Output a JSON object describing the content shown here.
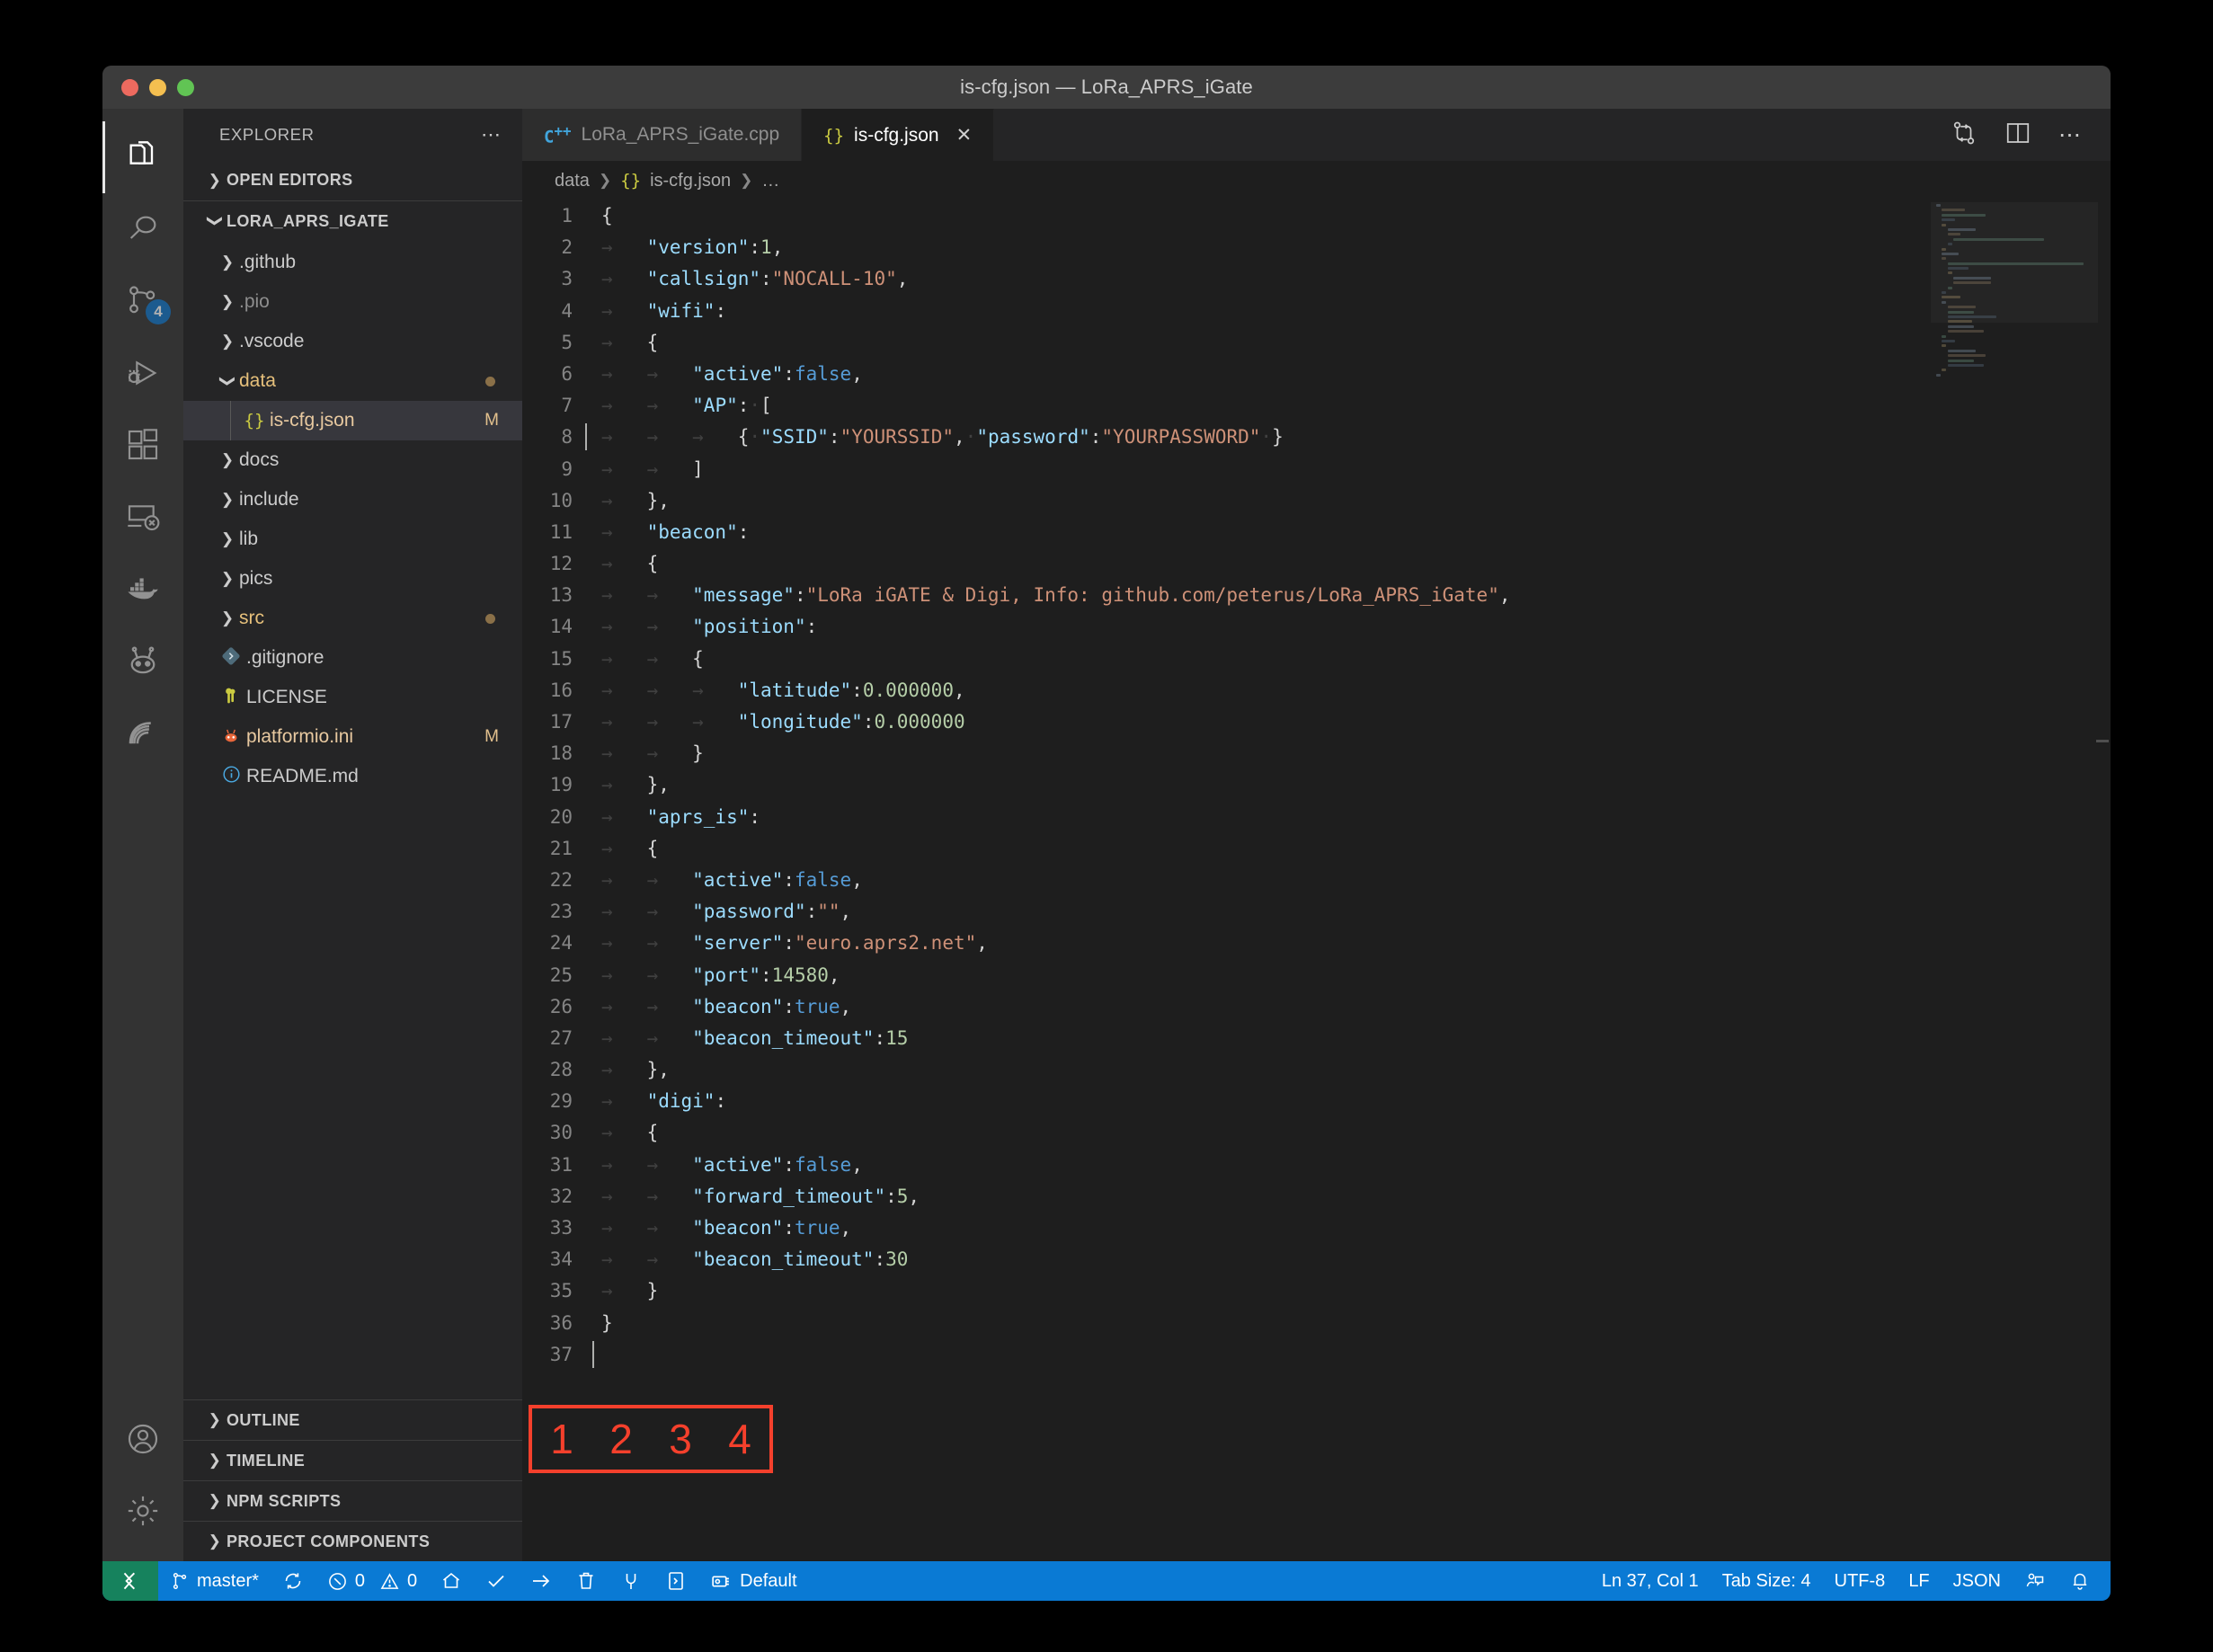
{
  "window": {
    "title": "is-cfg.json — LoRa_APRS_iGate"
  },
  "activitybar": {
    "items": [
      {
        "name": "explorer-icon",
        "badge": null
      },
      {
        "name": "search-icon",
        "badge": null
      },
      {
        "name": "source-control-icon",
        "badge": "4"
      },
      {
        "name": "run-and-debug-icon",
        "badge": null
      },
      {
        "name": "extensions-icon",
        "badge": null
      },
      {
        "name": "remote-explorer-icon",
        "badge": null
      },
      {
        "name": "docker-icon",
        "badge": null
      },
      {
        "name": "platformio-icon",
        "badge": null
      },
      {
        "name": "serial-monitor-icon",
        "badge": null
      }
    ],
    "bottom": [
      {
        "name": "accounts-icon"
      },
      {
        "name": "settings-gear-icon"
      }
    ]
  },
  "sidebar": {
    "header": "EXPLORER",
    "header_actions": "⋯",
    "open_editors": "OPEN EDITORS",
    "project": "LORA_APRS_IGATE",
    "tree": [
      {
        "label": ".github",
        "type": "folder",
        "expanded": false,
        "badge": "",
        "modified_dot": false
      },
      {
        "label": ".pio",
        "type": "folder",
        "expanded": false,
        "badge": "",
        "modified_dot": false,
        "dim": true
      },
      {
        "label": ".vscode",
        "type": "folder",
        "expanded": false,
        "badge": "",
        "modified_dot": false
      },
      {
        "label": "data",
        "type": "folder",
        "expanded": true,
        "badge": "",
        "modified_dot": true,
        "highlight": true
      },
      {
        "label": "is-cfg.json",
        "type": "json",
        "child": true,
        "badge": "M",
        "selected": true,
        "highlight": true
      },
      {
        "label": "docs",
        "type": "folder",
        "expanded": false,
        "badge": "",
        "modified_dot": false
      },
      {
        "label": "include",
        "type": "folder",
        "expanded": false,
        "badge": "",
        "modified_dot": false
      },
      {
        "label": "lib",
        "type": "folder",
        "expanded": false,
        "badge": "",
        "modified_dot": false
      },
      {
        "label": "pics",
        "type": "folder",
        "expanded": false,
        "badge": "",
        "modified_dot": false
      },
      {
        "label": "src",
        "type": "folder",
        "expanded": false,
        "badge": "",
        "modified_dot": true,
        "highlight": true
      },
      {
        "label": ".gitignore",
        "type": "git",
        "badge": "",
        "modified_dot": false
      },
      {
        "label": "LICENSE",
        "type": "key",
        "badge": "",
        "modified_dot": false
      },
      {
        "label": "platformio.ini",
        "type": "pio",
        "badge": "M",
        "highlight": true
      },
      {
        "label": "README.md",
        "type": "info",
        "badge": "",
        "modified_dot": false
      }
    ],
    "bottom_sections": [
      "OUTLINE",
      "TIMELINE",
      "NPM SCRIPTS",
      "PROJECT COMPONENTS"
    ]
  },
  "editor": {
    "tabs": [
      {
        "label": "LoRa_APRS_iGate.cpp",
        "icon": "cpp-icon",
        "active": false,
        "closable": false
      },
      {
        "label": "is-cfg.json",
        "icon": "json-icon",
        "active": true,
        "closable": true,
        "close": "✕"
      }
    ],
    "actions": [
      {
        "name": "split-diff-icon"
      },
      {
        "name": "split-editor-icon"
      },
      {
        "name": "more-actions-icon",
        "label": "⋯"
      }
    ],
    "breadcrumb": [
      "data",
      "is-cfg.json",
      "…"
    ],
    "lines": [
      {
        "n": 1,
        "text": "{"
      },
      {
        "n": 2,
        "text": "    \"version\":1,"
      },
      {
        "n": 3,
        "text": "    \"callsign\":\"NOCALL-10\","
      },
      {
        "n": 4,
        "text": "    \"wifi\":"
      },
      {
        "n": 5,
        "text": "    {"
      },
      {
        "n": 6,
        "text": "        \"active\":false,"
      },
      {
        "n": 7,
        "text": "        \"AP\": ["
      },
      {
        "n": 8,
        "text": "            { \"SSID\":\"YOURSSID\", \"password\":\"YOURPASSWORD\" }"
      },
      {
        "n": 9,
        "text": "        ]"
      },
      {
        "n": 10,
        "text": "    },"
      },
      {
        "n": 11,
        "text": "    \"beacon\":"
      },
      {
        "n": 12,
        "text": "    {"
      },
      {
        "n": 13,
        "text": "        \"message\":\"LoRa iGATE & Digi, Info: github.com/peterus/LoRa_APRS_iGate\","
      },
      {
        "n": 14,
        "text": "        \"position\":"
      },
      {
        "n": 15,
        "text": "        {"
      },
      {
        "n": 16,
        "text": "            \"latitude\":0.000000,"
      },
      {
        "n": 17,
        "text": "            \"longitude\":0.000000"
      },
      {
        "n": 18,
        "text": "        }"
      },
      {
        "n": 19,
        "text": "    },"
      },
      {
        "n": 20,
        "text": "    \"aprs_is\":"
      },
      {
        "n": 21,
        "text": "    {"
      },
      {
        "n": 22,
        "text": "        \"active\":false,"
      },
      {
        "n": 23,
        "text": "        \"password\":\"\","
      },
      {
        "n": 24,
        "text": "        \"server\":\"euro.aprs2.net\","
      },
      {
        "n": 25,
        "text": "        \"port\":14580,"
      },
      {
        "n": 26,
        "text": "        \"beacon\":true,"
      },
      {
        "n": 27,
        "text": "        \"beacon_timeout\":15"
      },
      {
        "n": 28,
        "text": "    },"
      },
      {
        "n": 29,
        "text": "    \"digi\":"
      },
      {
        "n": 30,
        "text": "    {"
      },
      {
        "n": 31,
        "text": "        \"active\":false,"
      },
      {
        "n": 32,
        "text": "        \"forward_timeout\":5,"
      },
      {
        "n": 33,
        "text": "        \"beacon\":true,"
      },
      {
        "n": 34,
        "text": "        \"beacon_timeout\":30"
      },
      {
        "n": 35,
        "text": "    }"
      },
      {
        "n": 36,
        "text": "}"
      },
      {
        "n": 37,
        "text": ""
      }
    ],
    "cursor_line": 37
  },
  "statusbar": {
    "remote_icon": "remote-window-icon",
    "left": [
      {
        "name": "branch",
        "icon": "source-control-branch-icon",
        "label": "master*"
      },
      {
        "name": "sync",
        "icon": "sync-icon",
        "label": ""
      },
      {
        "name": "problems",
        "icon": "error-icon",
        "label": "0",
        "icon2": "warning-icon",
        "label2": "0"
      },
      {
        "name": "pio-home",
        "icon": "home-icon",
        "label": ""
      },
      {
        "name": "pio-build",
        "icon": "check-icon",
        "label": ""
      },
      {
        "name": "pio-upload",
        "icon": "arrow-right-icon",
        "label": ""
      },
      {
        "name": "pio-clean",
        "icon": "trash-icon",
        "label": ""
      },
      {
        "name": "pio-serial-monitor",
        "icon": "plug-icon",
        "label": ""
      },
      {
        "name": "pio-terminal",
        "icon": "terminal-icon",
        "label": ""
      },
      {
        "name": "pio-env",
        "icon": "board-icon",
        "label": "Default"
      }
    ],
    "right": [
      {
        "name": "cursor-position",
        "label": "Ln 37, Col 1"
      },
      {
        "name": "tab-size",
        "label": "Tab Size: 4"
      },
      {
        "name": "encoding",
        "label": "UTF-8"
      },
      {
        "name": "eol",
        "label": "LF"
      },
      {
        "name": "language-mode",
        "label": "JSON"
      },
      {
        "name": "feedback-icon",
        "label": ""
      },
      {
        "name": "notifications-bell-icon",
        "label": ""
      }
    ]
  },
  "annotation": {
    "labels": [
      "1",
      "2",
      "3",
      "4"
    ],
    "color": "#f5402c"
  }
}
